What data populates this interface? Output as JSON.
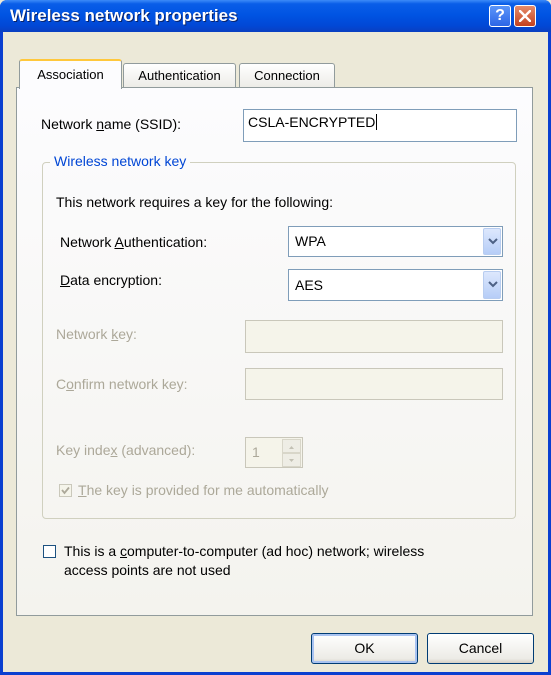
{
  "window": {
    "title": "Wireless network properties"
  },
  "tabs": [
    {
      "label": "Association",
      "active": true
    },
    {
      "label": "Authentication",
      "active": false
    },
    {
      "label": "Connection",
      "active": false
    }
  ],
  "association": {
    "ssid_label": "Network name (SSID):",
    "ssid_value": "CSLA-ENCRYPTED",
    "group_title": "Wireless network key",
    "requires_text": "This network requires a key for the following:",
    "auth_label": "Network Authentication:",
    "auth_value": "WPA",
    "encryption_label": "Data encryption:",
    "encryption_value": "AES",
    "network_key_label": "Network key:",
    "network_key_value": "",
    "confirm_key_label": "Confirm network key:",
    "confirm_key_value": "",
    "key_index_label": "Key index (advanced):",
    "key_index_value": "1",
    "auto_key_label": "The key is provided for me automatically",
    "auto_key_checked": true,
    "adhoc_label_line1": "This is a computer-to-computer (ad hoc) network; wireless",
    "adhoc_label_line2": "access points are not used",
    "adhoc_checked": false
  },
  "buttons": {
    "ok": "OK",
    "cancel": "Cancel"
  },
  "colors": {
    "titlebar": "#0054e3",
    "dialog_bg": "#ece9d8",
    "group_title": "#0046d5",
    "tab_highlight": "#ffc83c"
  },
  "icons": {
    "help": "question-mark-icon",
    "close": "close-x-icon",
    "dropdown": "chevron-down-icon",
    "check": "check-icon"
  }
}
